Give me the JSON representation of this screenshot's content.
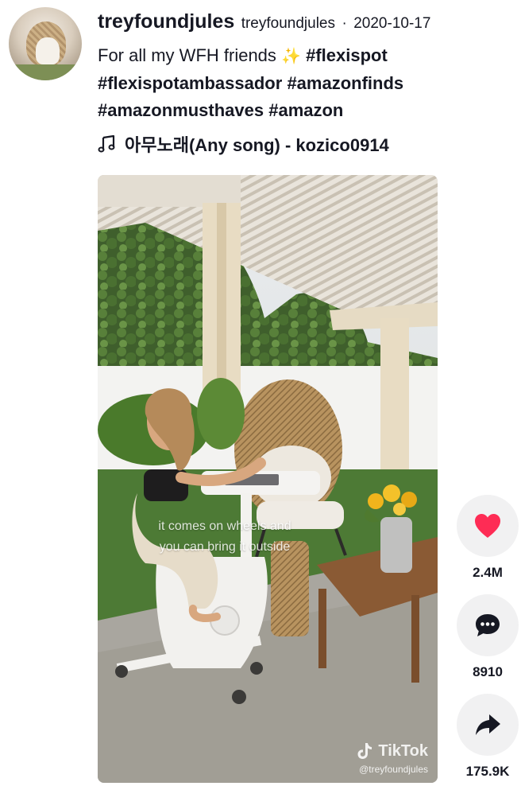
{
  "author": {
    "username": "treyfoundjules",
    "nickname": "treyfoundjules",
    "separator": "·",
    "date": "2020-10-17"
  },
  "caption": {
    "text": "For all my WFH friends",
    "emoji": "✨",
    "hashtags": [
      "#flexispot",
      "#flexispotambassador",
      "#amazonfinds",
      "#amazonmusthaves",
      "#amazon"
    ]
  },
  "music": {
    "icon": "music-note-icon",
    "title": "아무노래(Any song) - kozico0914"
  },
  "video": {
    "overlay_line1": "it comes on wheels and",
    "overlay_line2": "you can bring it outside",
    "watermark_brand": "TikTok",
    "watermark_handle": "@treyfoundjules"
  },
  "actions": {
    "like_count": "2.4M",
    "comment_count": "8910",
    "share_count": "175.9K",
    "like_color": "#fe2c55"
  }
}
